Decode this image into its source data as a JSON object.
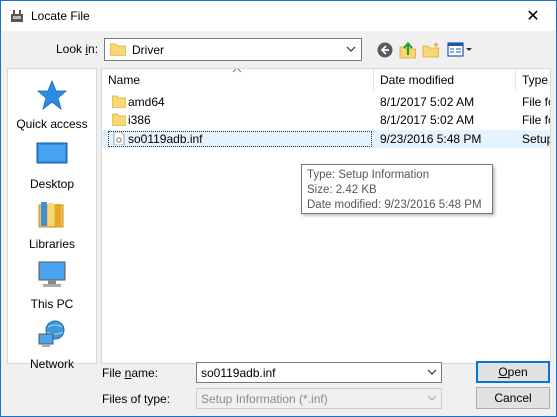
{
  "window": {
    "title": "Locate File",
    "close_glyph": "✕"
  },
  "toolbar": {
    "lookin_label_prefix": "Look ",
    "lookin_label_accel": "i",
    "lookin_label_suffix": "n:",
    "lookin_value": "Driver",
    "icons": [
      "back-icon",
      "up-folder-icon",
      "new-folder-icon",
      "view-menu-icon"
    ]
  },
  "places": [
    {
      "label": "Quick access",
      "icon": "quick-access-star-icon"
    },
    {
      "label": "Desktop",
      "icon": "desktop-icon"
    },
    {
      "label": "Libraries",
      "icon": "libraries-icon"
    },
    {
      "label": "This PC",
      "icon": "this-pc-icon"
    },
    {
      "label": "Network",
      "icon": "network-icon"
    }
  ],
  "filelist": {
    "columns": [
      "Name",
      "Date modified",
      "Type"
    ],
    "rows": [
      {
        "name": "amd64",
        "date": "8/1/2017 5:02 AM",
        "type": "File fo",
        "kind": "folder"
      },
      {
        "name": "i386",
        "date": "8/1/2017 5:02 AM",
        "type": "File fo",
        "kind": "folder"
      },
      {
        "name": "so0119adb.inf",
        "date": "9/23/2016 5:48 PM",
        "type": "Setup",
        "kind": "file",
        "selected": true
      }
    ]
  },
  "tooltip": {
    "line1": "Type: Setup Information",
    "line2": "Size: 2.42 KB",
    "line3": "Date modified: 9/23/2016 5:48 PM"
  },
  "footer": {
    "filename_label_prefix": "File ",
    "filename_label_accel": "n",
    "filename_label_suffix": "ame:",
    "filename_value": "so0119adb.inf",
    "filetype_label": "Files of type:",
    "filetype_value": "Setup Information (*.inf)",
    "open_label_accel": "O",
    "open_label_suffix": "pen",
    "cancel_label": "Cancel"
  },
  "colors": {
    "accent": "#0078d7",
    "folder": "#f8d775",
    "selection": "#e5f3ff"
  }
}
